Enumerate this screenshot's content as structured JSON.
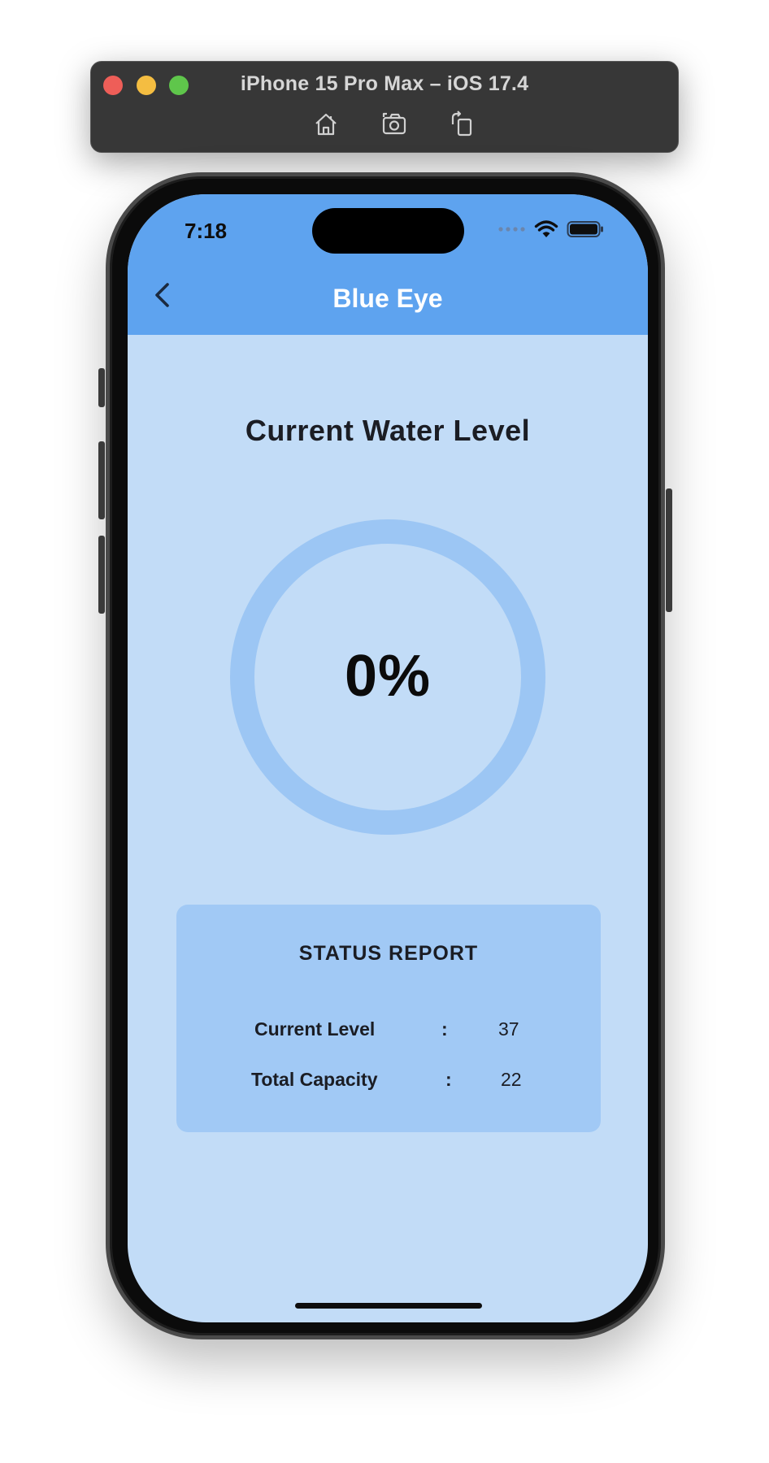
{
  "simulator": {
    "title": "iPhone 15 Pro Max – iOS 17.4",
    "icons": [
      "home-icon",
      "screenshot-icon",
      "rotate-icon"
    ]
  },
  "status_bar": {
    "time": "7:18"
  },
  "header": {
    "title": "Blue Eye",
    "back_icon": "chevron-left-icon"
  },
  "main": {
    "title": "Current Water Level",
    "gauge": {
      "value_text": "0%",
      "level_percent": 0
    }
  },
  "status_report": {
    "title": "STATUS REPORT",
    "rows": [
      {
        "label": "Current Level",
        "separator": ":",
        "value": "37"
      },
      {
        "label": "Total Capacity",
        "separator": ":",
        "value": "22"
      }
    ]
  },
  "colors": {
    "header_bg": "#5ea3ef",
    "screen_bg": "#c2dcf7",
    "ring": "#9cc6f4",
    "card_bg": "#a1c9f5"
  }
}
